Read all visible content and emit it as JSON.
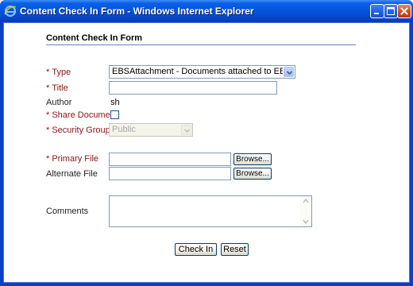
{
  "window": {
    "title": "Content Check In Form - Windows Internet Explorer"
  },
  "form": {
    "heading": "Content Check In Form",
    "fields": {
      "type": {
        "label": "Type",
        "required": true,
        "value": "EBSAttachment - Documents attached to EBS Entities"
      },
      "title": {
        "label": "Title",
        "required": true,
        "value": ""
      },
      "author": {
        "label": "Author",
        "required": false,
        "value": "sh"
      },
      "share_document": {
        "label": "Share Document",
        "required": true,
        "checked": false
      },
      "security_group": {
        "label": "Security Group",
        "required": true,
        "value": "Public",
        "disabled": true
      },
      "primary_file": {
        "label": "Primary File",
        "required": true,
        "value": "",
        "browse_label": "Browse..."
      },
      "alternate_file": {
        "label": "Alternate File",
        "required": false,
        "value": "",
        "browse_label": "Browse..."
      },
      "comments": {
        "label": "Comments",
        "value": ""
      }
    },
    "actions": {
      "check_in_label": "Check In",
      "reset_label": "Reset"
    }
  },
  "colors": {
    "titlebar": "#0552da",
    "required_label": "#8b1414",
    "required_star": "#c00000"
  }
}
